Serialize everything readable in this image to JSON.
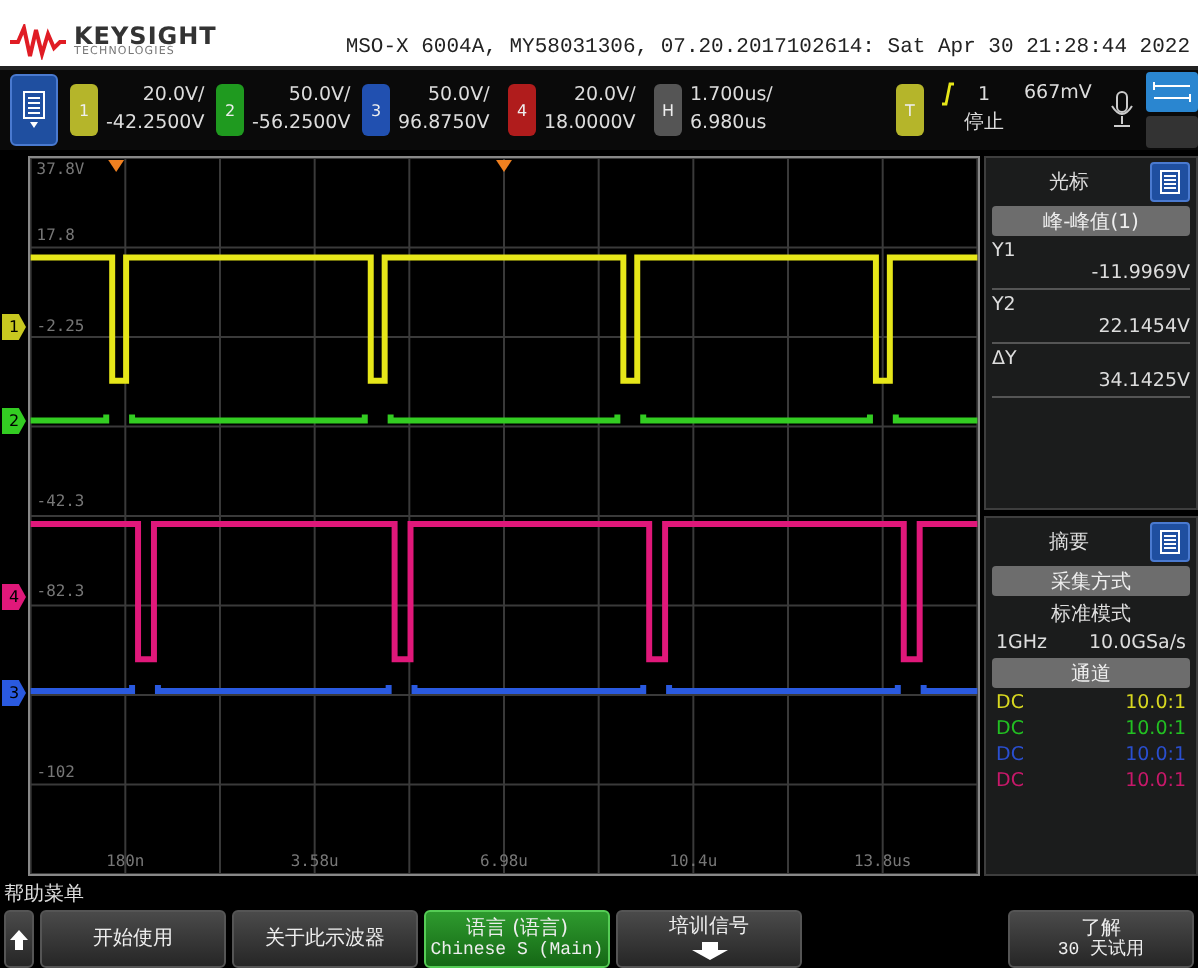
{
  "header": {
    "logo_text": "KEYSIGHT",
    "logo_subtext": "TECHNOLOGIES",
    "instrument_info": "MSO-X 6004A, MY58031306, 07.20.2017102614: Sat Apr 30 21:28:44 2022"
  },
  "channels": [
    {
      "label": "1",
      "scale": "20.0V/",
      "offset": "-42.2500V",
      "color": "#b5b52a"
    },
    {
      "label": "2",
      "scale": "50.0V/",
      "offset": "-56.2500V",
      "color": "#1f9a1f"
    },
    {
      "label": "3",
      "scale": "50.0V/",
      "offset": "96.8750V",
      "color": "#2150b0"
    },
    {
      "label": "4",
      "scale": "20.0V/",
      "offset": "18.0000V",
      "color": "#b01c1c"
    }
  ],
  "horizontal": {
    "label": "H",
    "scale": "1.700us/",
    "delay": "6.980us"
  },
  "trigger": {
    "label": "T",
    "source": "1",
    "status": "停止",
    "level": "667mV"
  },
  "graticule": {
    "y_labels": [
      "37.8V",
      "17.8",
      "-2.25",
      "-42.3",
      "-82.3",
      "-102"
    ],
    "x_labels": [
      "180n",
      "3.58u",
      "6.98u",
      "10.4u",
      "13.8us"
    ],
    "traces": [
      {
        "kind": "pulse",
        "color": "#e6e619"
      },
      {
        "kind": "gapped",
        "color": "#33cc22"
      },
      {
        "kind": "pulse",
        "color": "#e0187a"
      },
      {
        "kind": "gapped",
        "color": "#2a5ae0"
      }
    ],
    "ground_markers": [
      {
        "label": "1",
        "color": "#c8c820"
      },
      {
        "label": "2",
        "color": "#33cc22"
      },
      {
        "label": "4",
        "color": "#e0187a"
      },
      {
        "label": "3",
        "color": "#2a5ae0"
      }
    ]
  },
  "cursor_panel": {
    "title": "光标",
    "mode_button": "峰-峰值(1)",
    "readings": [
      {
        "label": "Y1",
        "value": "-11.9969V"
      },
      {
        "label": "Y2",
        "value": "22.1454V"
      },
      {
        "label": "ΔY",
        "value": "34.1425V"
      }
    ]
  },
  "summary_panel": {
    "title": "摘要",
    "acquisition_header": "采集方式",
    "mode": "标准模式",
    "bandwidth": "1GHz",
    "sample_rate": "10.0GSa/s",
    "channels_header": "通道",
    "rows": [
      {
        "coupling": "DC",
        "probe": "10.0:1",
        "color": "#d8d820"
      },
      {
        "coupling": "DC",
        "probe": "10.0:1",
        "color": "#22c022"
      },
      {
        "coupling": "DC",
        "probe": "10.0:1",
        "color": "#2a4fd0"
      },
      {
        "coupling": "DC",
        "probe": "10.0:1",
        "color": "#c8186a"
      }
    ]
  },
  "softkeys": {
    "help_label": "帮助菜单",
    "keys": [
      {
        "kind": "up-arrow",
        "selected": false
      },
      {
        "kind": "text",
        "lines": [
          "开始使用"
        ],
        "selected": false
      },
      {
        "kind": "text",
        "lines": [
          "关于此示波器"
        ],
        "selected": false
      },
      {
        "kind": "text",
        "lines": [
          "语言 (语言)",
          "Chinese S (Main)"
        ],
        "selected": true
      },
      {
        "kind": "down-arrow",
        "lines": [
          "培训信号"
        ],
        "selected": false
      },
      {
        "kind": "text",
        "lines": [
          "了解",
          "30 天试用"
        ],
        "selected": false
      }
    ]
  }
}
